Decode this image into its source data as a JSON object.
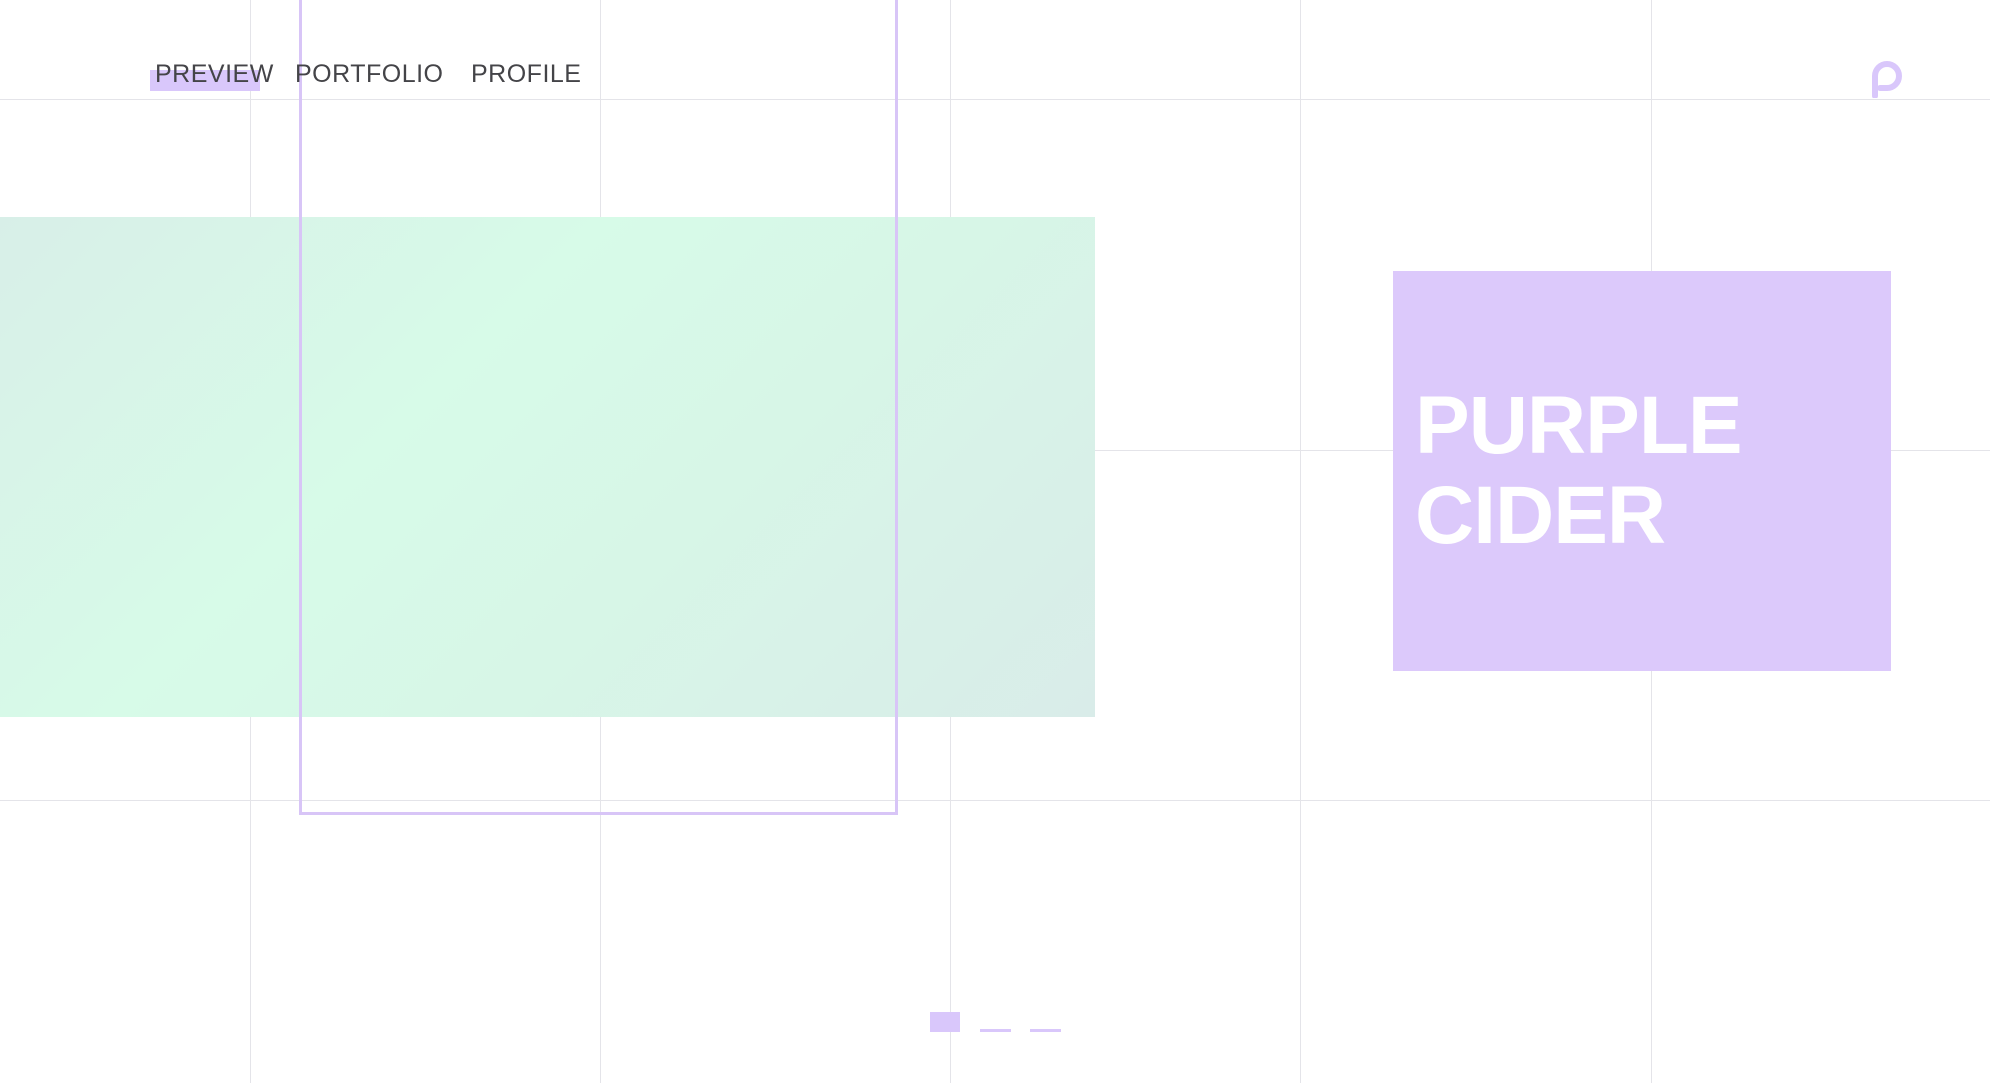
{
  "nav": {
    "items": [
      {
        "label": "PREVIEW",
        "active": true
      },
      {
        "label": "PORTFOLIO",
        "active": false
      },
      {
        "label": "PROFILE",
        "active": false
      }
    ]
  },
  "brand": {
    "logo_icon": "p-letter-logo-icon",
    "accent_color": "#d9c7fb",
    "mint_color": "#d7fbe8"
  },
  "hero": {
    "title": "PURPLE\nCIDER"
  },
  "pager": {
    "slides": 3,
    "current": 1
  }
}
